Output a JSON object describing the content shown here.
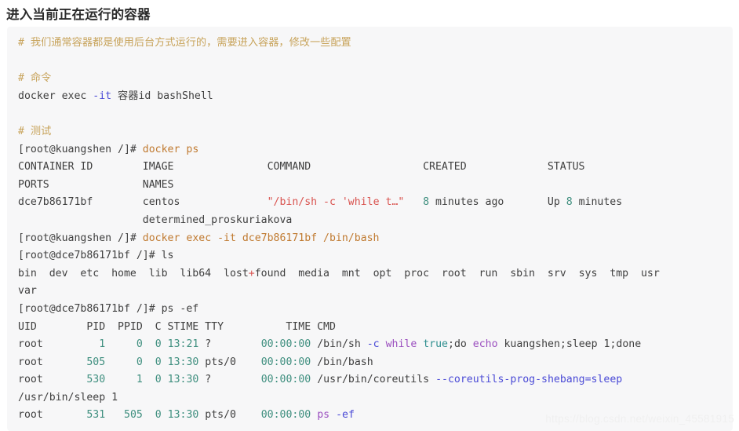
{
  "page": {
    "title": "进入当前正在运行的容器",
    "watermark": "https://blog.csdn.net/weixin_45581915",
    "colors": {
      "background": "#ffffff",
      "code_background": "#f7f7f8",
      "text": "#3f3f3f",
      "comment": "#c8a45c",
      "command": "#c07a30",
      "flag": "#4a4ad6",
      "string": "#d9534f",
      "number": "#3f8f7f",
      "keyword": "#9b4fbf",
      "heading": "#2b2b2b",
      "watermark": "#f0f0f0"
    }
  },
  "code": {
    "lines": [
      {
        "id": "l1",
        "tokens": [
          {
            "t": "# 我们通常容器都是使用后台方式运行的，需要进入容器，修改一些配置",
            "c": "c-comment"
          }
        ]
      },
      {
        "id": "l2",
        "tokens": []
      },
      {
        "id": "l3",
        "tokens": [
          {
            "t": "# 命令",
            "c": "c-comment"
          }
        ]
      },
      {
        "id": "l4",
        "tokens": [
          {
            "t": "docker exec ",
            "c": "c-default"
          },
          {
            "t": "-it",
            "c": "c-flag"
          },
          {
            "t": " 容器id bashShell",
            "c": "c-default"
          }
        ]
      },
      {
        "id": "l5",
        "tokens": []
      },
      {
        "id": "l6",
        "tokens": [
          {
            "t": "# 测试",
            "c": "c-comment"
          }
        ]
      },
      {
        "id": "l7",
        "tokens": [
          {
            "t": "[root@kuangshen /]# ",
            "c": "c-default"
          },
          {
            "t": "docker ps",
            "c": "c-cmd"
          }
        ]
      },
      {
        "id": "l8",
        "tokens": [
          {
            "t": "CONTAINER ID        IMAGE               COMMAND                  CREATED             STATUS",
            "c": "c-head"
          }
        ]
      },
      {
        "id": "l9",
        "tokens": [
          {
            "t": "PORTS               NAMES",
            "c": "c-head"
          }
        ]
      },
      {
        "id": "l10",
        "tokens": [
          {
            "t": "dce7b86171bf        centos              ",
            "c": "c-default"
          },
          {
            "t": "\"/bin/sh -c 'while t…\"",
            "c": "c-str"
          },
          {
            "t": "   ",
            "c": "c-default"
          },
          {
            "t": "8",
            "c": "c-num"
          },
          {
            "t": " minutes ago       Up ",
            "c": "c-default"
          },
          {
            "t": "8",
            "c": "c-num"
          },
          {
            "t": " minutes",
            "c": "c-default"
          }
        ]
      },
      {
        "id": "l11",
        "tokens": [
          {
            "t": "                    determined_proskuriakova",
            "c": "c-default"
          }
        ]
      },
      {
        "id": "l12",
        "tokens": [
          {
            "t": "[root@kuangshen /]# ",
            "c": "c-default"
          },
          {
            "t": "docker exec -it dce7b86171bf /bin/bash",
            "c": "c-cmd"
          }
        ]
      },
      {
        "id": "l13",
        "tokens": [
          {
            "t": "[root@dce7b86171bf /]# ls",
            "c": "c-default"
          }
        ]
      },
      {
        "id": "l14",
        "tokens": [
          {
            "t": "bin  dev  etc  home  lib  lib64  lost",
            "c": "c-default"
          },
          {
            "t": "+",
            "c": "c-plus"
          },
          {
            "t": "found  media  mnt  opt  proc  root  run  sbin  srv  sys  tmp  usr",
            "c": "c-default"
          }
        ]
      },
      {
        "id": "l15",
        "tokens": [
          {
            "t": "var",
            "c": "c-default"
          }
        ]
      },
      {
        "id": "l16",
        "tokens": [
          {
            "t": "[root@dce7b86171bf /]# ps -ef",
            "c": "c-default"
          }
        ]
      },
      {
        "id": "l17",
        "tokens": [
          {
            "t": "UID        PID  PPID  C STIME TTY          TIME CMD",
            "c": "c-head"
          }
        ]
      },
      {
        "id": "l18",
        "tokens": [
          {
            "t": "root         ",
            "c": "c-default"
          },
          {
            "t": "1",
            "c": "c-num"
          },
          {
            "t": "     ",
            "c": "c-default"
          },
          {
            "t": "0",
            "c": "c-num"
          },
          {
            "t": "  ",
            "c": "c-default"
          },
          {
            "t": "0",
            "c": "c-num"
          },
          {
            "t": " ",
            "c": "c-default"
          },
          {
            "t": "13:21",
            "c": "c-num"
          },
          {
            "t": " ?        ",
            "c": "c-default"
          },
          {
            "t": "00:00:00",
            "c": "c-num"
          },
          {
            "t": " /bin/sh ",
            "c": "c-default"
          },
          {
            "t": "-c",
            "c": "c-flag"
          },
          {
            "t": " ",
            "c": "c-default"
          },
          {
            "t": "while",
            "c": "c-kw"
          },
          {
            "t": " ",
            "c": "c-default"
          },
          {
            "t": "true",
            "c": "c-teal"
          },
          {
            "t": ";do ",
            "c": "c-default"
          },
          {
            "t": "echo",
            "c": "c-kw"
          },
          {
            "t": " kuangshen;sleep ",
            "c": "c-default"
          },
          {
            "t": "1",
            "c": "c-default"
          },
          {
            "t": ";done",
            "c": "c-default"
          }
        ]
      },
      {
        "id": "l19",
        "tokens": [
          {
            "t": "root       ",
            "c": "c-default"
          },
          {
            "t": "505",
            "c": "c-num"
          },
          {
            "t": "     ",
            "c": "c-default"
          },
          {
            "t": "0",
            "c": "c-num"
          },
          {
            "t": "  ",
            "c": "c-default"
          },
          {
            "t": "0",
            "c": "c-num"
          },
          {
            "t": " ",
            "c": "c-default"
          },
          {
            "t": "13:30",
            "c": "c-num"
          },
          {
            "t": " pts/0    ",
            "c": "c-default"
          },
          {
            "t": "00:00:00",
            "c": "c-num"
          },
          {
            "t": " /bin/bash",
            "c": "c-default"
          }
        ]
      },
      {
        "id": "l20",
        "tokens": [
          {
            "t": "root       ",
            "c": "c-default"
          },
          {
            "t": "530",
            "c": "c-num"
          },
          {
            "t": "     ",
            "c": "c-default"
          },
          {
            "t": "1",
            "c": "c-num"
          },
          {
            "t": "  ",
            "c": "c-default"
          },
          {
            "t": "0",
            "c": "c-num"
          },
          {
            "t": " ",
            "c": "c-default"
          },
          {
            "t": "13:30",
            "c": "c-num"
          },
          {
            "t": " ?        ",
            "c": "c-default"
          },
          {
            "t": "00:00:00",
            "c": "c-num"
          },
          {
            "t": " /usr/bin/coreutils ",
            "c": "c-default"
          },
          {
            "t": "--coreutils-prog-shebang=sleep",
            "c": "c-flag"
          }
        ]
      },
      {
        "id": "l21",
        "tokens": [
          {
            "t": "/usr/bin/sleep ",
            "c": "c-default"
          },
          {
            "t": "1",
            "c": "c-default"
          }
        ]
      },
      {
        "id": "l22",
        "tokens": [
          {
            "t": "root       ",
            "c": "c-default"
          },
          {
            "t": "531",
            "c": "c-num"
          },
          {
            "t": "   ",
            "c": "c-default"
          },
          {
            "t": "505",
            "c": "c-num"
          },
          {
            "t": "  ",
            "c": "c-default"
          },
          {
            "t": "0",
            "c": "c-num"
          },
          {
            "t": " ",
            "c": "c-default"
          },
          {
            "t": "13:30",
            "c": "c-num"
          },
          {
            "t": " pts/0    ",
            "c": "c-default"
          },
          {
            "t": "00:00:00",
            "c": "c-num"
          },
          {
            "t": " ",
            "c": "c-default"
          },
          {
            "t": "ps",
            "c": "c-kw"
          },
          {
            "t": " ",
            "c": "c-default"
          },
          {
            "t": "-ef",
            "c": "c-flag"
          }
        ]
      }
    ]
  }
}
